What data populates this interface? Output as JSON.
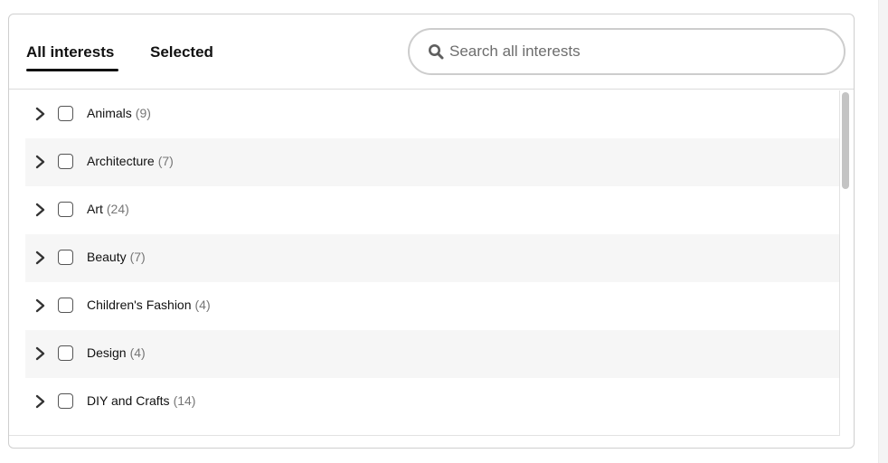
{
  "tabs": {
    "all_label": "All interests",
    "selected_label": "Selected"
  },
  "search": {
    "placeholder": "Search all interests",
    "value": "",
    "icon": "search-icon"
  },
  "interests": [
    {
      "label": "Animals",
      "count": "(9)"
    },
    {
      "label": "Architecture",
      "count": "(7)"
    },
    {
      "label": "Art",
      "count": "(24)"
    },
    {
      "label": "Beauty",
      "count": "(7)"
    },
    {
      "label": "Children's Fashion",
      "count": "(4)"
    },
    {
      "label": "Design",
      "count": "(4)"
    },
    {
      "label": "DIY and Crafts",
      "count": "(14)"
    }
  ],
  "colors": {
    "text": "#111111",
    "muted": "#767676",
    "row_alt": "#f6f6f6",
    "border": "#cfcfcf"
  }
}
